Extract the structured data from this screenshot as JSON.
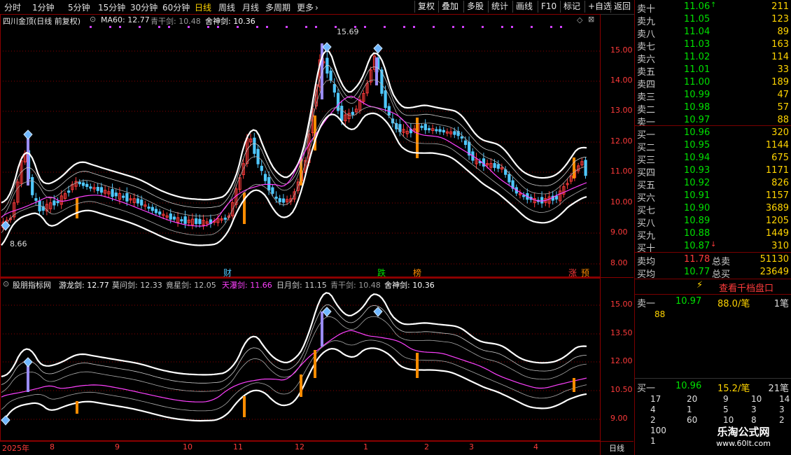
{
  "toolbar": {
    "periods": [
      "分时",
      "1分钟",
      "5分钟",
      "15分钟",
      "30分钟",
      "60分钟",
      "日线",
      "周线",
      "月线",
      "多周期",
      "更多"
    ],
    "active_period": "日线",
    "more_chevron": "›",
    "buttons": [
      "复权",
      "叠加",
      "多股",
      "统计",
      "画线",
      "F10",
      "标记",
      "+自选",
      "返回"
    ]
  },
  "upper_panel": {
    "title": "四川金顶(日线 前复权)",
    "indicator_name": "MA60: 12.77",
    "line_qinggan": "青干剑: 10.48",
    "line_sheshen": "舍神剑: 10.36",
    "high_label": "15.69",
    "low_label": "8.66",
    "y_axis_labels": [
      "15.00",
      "14.00",
      "13.00",
      "12.00",
      "11.00",
      "10.00",
      "9.00",
      "8.00"
    ],
    "signal_cai": "财",
    "signal_die": "跌",
    "signal_bang": "榜",
    "signal_zhang": "涨",
    "signal_yu": "预",
    "colors": {
      "up": "#ff3b3b",
      "down": "#4fc8ff",
      "band": "#ffffff",
      "ma": "#ff40ff",
      "accent": "#ff8c00",
      "grid": "#8b0000"
    }
  },
  "lower_panel": {
    "title": "股朋指标网",
    "youlong": "游龙剑: 12.77",
    "mowen": "莫问剑: 12.33",
    "jingxing": "竟星剑: 12.05",
    "tianpu": "天瀑剑: 11.66",
    "riyue": "日月剑: 11.15",
    "qinggan": "青干剑: 10.48",
    "sheshen": "舍神剑: 10.36",
    "y_axis_labels": [
      "15.00",
      "13.50",
      "12.00",
      "10.50",
      "9.00"
    ]
  },
  "time_axis": {
    "labels": [
      "2025年",
      "8",
      "9",
      "10",
      "11",
      "12",
      "1",
      "2",
      "3",
      "4"
    ],
    "period_label": "日线"
  },
  "orderbook": {
    "asks": [
      {
        "label": "卖十",
        "price": "11.06",
        "vol": "211",
        "flag": "↑"
      },
      {
        "label": "卖九",
        "price": "11.05",
        "vol": "123"
      },
      {
        "label": "卖八",
        "price": "11.04",
        "vol": "89"
      },
      {
        "label": "卖七",
        "price": "11.03",
        "vol": "163"
      },
      {
        "label": "卖六",
        "price": "11.02",
        "vol": "114"
      },
      {
        "label": "卖五",
        "price": "11.01",
        "vol": "33"
      },
      {
        "label": "卖四",
        "price": "11.00",
        "vol": "189"
      },
      {
        "label": "卖三",
        "price": "10.99",
        "vol": "47"
      },
      {
        "label": "卖二",
        "price": "10.98",
        "vol": "57"
      },
      {
        "label": "卖一",
        "price": "10.97",
        "vol": "88"
      }
    ],
    "bids": [
      {
        "label": "买一",
        "price": "10.96",
        "vol": "320"
      },
      {
        "label": "买二",
        "price": "10.95",
        "vol": "1144"
      },
      {
        "label": "买三",
        "price": "10.94",
        "vol": "675"
      },
      {
        "label": "买四",
        "price": "10.93",
        "vol": "1171"
      },
      {
        "label": "买五",
        "price": "10.92",
        "vol": "826"
      },
      {
        "label": "买六",
        "price": "10.91",
        "vol": "1157"
      },
      {
        "label": "买七",
        "price": "10.90",
        "vol": "3689"
      },
      {
        "label": "买八",
        "price": "10.89",
        "vol": "1205"
      },
      {
        "label": "买九",
        "price": "10.88",
        "vol": "1449"
      },
      {
        "label": "买十",
        "price": "10.87",
        "vol": "310",
        "flag": "↓"
      }
    ],
    "avg_sell": {
      "label": "卖均",
      "price": "11.78",
      "total_label": "总卖",
      "total": "51130"
    },
    "avg_buy": {
      "label": "买均",
      "price": "10.77",
      "total_label": "总买",
      "total": "23649"
    },
    "view_ten_levels": "查看千档盘口",
    "sell1_detail": {
      "label": "卖一",
      "price": "10.97",
      "qty": "88.0/笔",
      "count": "1笔",
      "orders": [
        "88"
      ]
    },
    "buy1_detail": {
      "label": "买一",
      "price": "10.96",
      "qty": "15.2/笔",
      "count": "21笔",
      "orders": [
        [
          "17",
          "20",
          "9",
          "10",
          "14"
        ],
        [
          "4",
          "1",
          "5",
          "3",
          "3"
        ],
        [
          "2",
          "60",
          "10",
          "8",
          "2"
        ],
        [
          "100"
        ],
        [
          "1"
        ]
      ]
    },
    "watermark": "乐淘公式网",
    "watermark_url": "www.60lt.com"
  }
}
